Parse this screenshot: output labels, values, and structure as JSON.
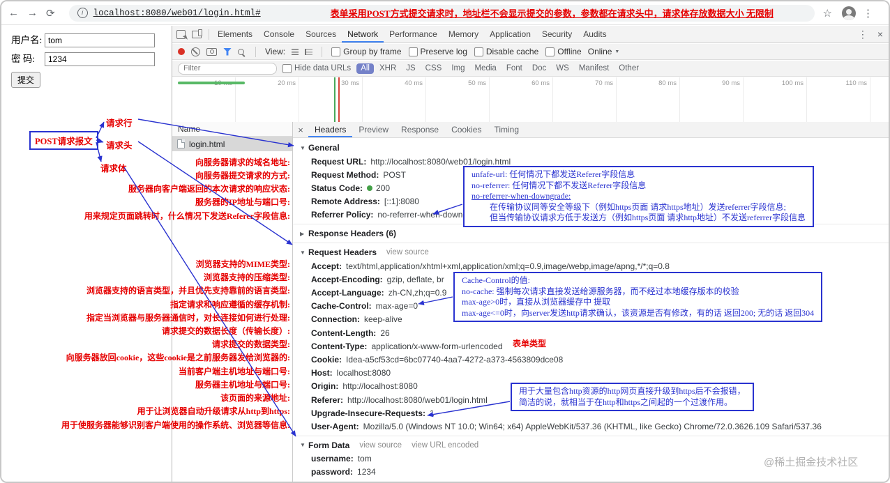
{
  "colors": {
    "accent_blue": "#2a33d0",
    "annotation_red": "#e60000",
    "status_green": "#43a047",
    "filter_active_bg": "#7481c8",
    "tab_underline": "#4285f4"
  },
  "icons": {
    "back": "←",
    "forward": "→",
    "reload": "⟳",
    "page_info": "i",
    "star": "☆",
    "menu": "⋮",
    "devtools_overflow": "⋮",
    "devtools_close": "×",
    "detail_close": "×",
    "collapsed_triangle": "▶",
    "expanded_triangle": "▼",
    "dropdown_caret": "▼"
  },
  "browser": {
    "url": "localhost:8080/web01/login.html#",
    "annotation": "表单采用POST方式提交请求时，地址栏不会显示提交的参数，参数都在请求头中，请求体存放数据大小 无限制"
  },
  "page_form": {
    "username_label": "用户名:",
    "username_value": "tom",
    "password_label": "密 码:",
    "password_value": "1234",
    "submit_label": "提交"
  },
  "devtools": {
    "tabs": [
      "Elements",
      "Console",
      "Sources",
      "Network",
      "Performance",
      "Memory",
      "Application",
      "Security",
      "Audits"
    ],
    "active_tab": "Network",
    "toolbar": {
      "view_label": "View:",
      "checkboxes": [
        "Group by frame",
        "Preserve log",
        "Disable cache",
        "Offline"
      ],
      "throttling": "Online"
    },
    "filter_bar": {
      "placeholder": "Filter",
      "hide_data_urls": "Hide data URLs",
      "types": [
        "All",
        "XHR",
        "JS",
        "CSS",
        "Img",
        "Media",
        "Font",
        "Doc",
        "WS",
        "Manifest",
        "Other"
      ],
      "active_type": "All"
    },
    "timeline_ticks": [
      "10 ms",
      "20 ms",
      "30 ms",
      "40 ms",
      "50 ms",
      "60 ms",
      "70 ms",
      "80 ms",
      "90 ms",
      "100 ms",
      "110 ms"
    ],
    "request_table": {
      "name_header": "Name",
      "rows": [
        "login.html"
      ]
    },
    "detail": {
      "tabs": [
        "Headers",
        "Preview",
        "Response",
        "Cookies",
        "Timing"
      ],
      "active_tab": "Headers",
      "general_title": "General",
      "general_rows": [
        {
          "key": "Request URL:",
          "value": "http://localhost:8080/web01/login.html"
        },
        {
          "key": "Request Method:",
          "value": "POST"
        },
        {
          "key": "Status Code:",
          "value": "200"
        },
        {
          "key": "Remote Address:",
          "value": "[::1]:8080"
        },
        {
          "key": "Referrer Policy:",
          "value": "no-referrer-when-downgrade"
        }
      ],
      "response_headers_title": "Response Headers (6)",
      "request_headers_title": "Request Headers",
      "view_source": "view source",
      "request_rows": [
        {
          "key": "Accept:",
          "value": "text/html,application/xhtml+xml,application/xml;q=0.9,image/webp,image/apng,*/*;q=0.8"
        },
        {
          "key": "Accept-Encoding:",
          "value": "gzip, deflate, br"
        },
        {
          "key": "Accept-Language:",
          "value": "zh-CN,zh;q=0.9"
        },
        {
          "key": "Cache-Control:",
          "value": "max-age=0"
        },
        {
          "key": "Connection:",
          "value": "keep-alive"
        },
        {
          "key": "Content-Length:",
          "value": "26"
        },
        {
          "key": "Content-Type:",
          "value": "application/x-www-form-urlencoded"
        },
        {
          "key": "Cookie:",
          "value": "Idea-a5cf53cd=6bc07740-4aa7-4272-a373-4563809dce08"
        },
        {
          "key": "Host:",
          "value": "localhost:8080"
        },
        {
          "key": "Origin:",
          "value": "http://localhost:8080"
        },
        {
          "key": "Referer:",
          "value": "http://localhost:8080/web01/login.html"
        },
        {
          "key": "Upgrade-Insecure-Requests:",
          "value": "1"
        },
        {
          "key": "User-Agent:",
          "value": "Mozilla/5.0 (Windows NT 10.0; Win64; x64) AppleWebKit/537.36 (KHTML, like Gecko) Chrome/72.0.3626.109 Safari/537.36"
        }
      ],
      "form_data_title": "Form Data",
      "form_view_source": "view source",
      "form_view_url_encoded": "view URL encoded",
      "form_rows": [
        {
          "key": "username:",
          "value": "tom"
        },
        {
          "key": "password:",
          "value": "1234"
        }
      ]
    }
  },
  "annotations": {
    "post_box": "POST请求报文",
    "request_line": "请求行",
    "request_headers": "请求头",
    "request_body": "请求体",
    "rows": [
      "向服务器请求的域名地址:",
      "向服务器提交请求的方式:",
      "服务器向客户端返回的本次请求的响应状态:",
      "服务器的IP地址与端口号:",
      "用来规定页面跳转时，什么情况下发送Referer字段信息:",
      "浏览器支持的MIME类型:",
      "浏览器支持的压缩类型:",
      "浏览器支持的语言类型，并且优先支持靠前的语言类型:",
      "指定请求和响应遵循的缓存机制:",
      "指定当浏览器与服务器通信时，对长连接如何进行处理:",
      "请求提交的数据长度（传输长度）:",
      "请求提交的数据类型:",
      "向服务器放回cookie，这些cookie是之前服务器发给浏览器的:",
      "当前客户端主机地址与端口号:",
      "服务器主机地址与端口号:",
      "该页面的来源地址:",
      "用于让浏览器自动升级请求从http到https:",
      "用于使服务器能够识别客户端使用的操作系统、浏览器等信息:"
    ],
    "content_type_note": "表单类型"
  },
  "callouts": {
    "referrer_lines": [
      "unfafe-url: 任何情况下都发送Referer字段信息",
      "no-referrer: 任何情况下都不发送Referer字段信息",
      "no-referrer-when-downgrade:",
      "在传输协议同等安全等级下（例如https页面 请求https地址）发送referrer字段信息;",
      "但当传输协议请求方低于发送方（例如https页面 请求http地址）不发送referrer字段信息"
    ],
    "cache_lines": [
      "Cache-Control的值:",
      "no-cache: 强制每次请求直接发送给源服务器，而不经过本地缓存版本的校验",
      "max-age>0时，直接从浏览器缓存中 提取",
      "max-age<=0时，向server发送http请求确认，该资源是否有修改，有的话 返回200; 无的话 返回304"
    ],
    "upgrade_lines": [
      "用于大量包含http资源的http网页直接升级到https后不会报错，",
      "简洁的说，就相当于在http和https之间起的一个过渡作用。"
    ]
  },
  "watermark": "@稀土掘金技术社区"
}
